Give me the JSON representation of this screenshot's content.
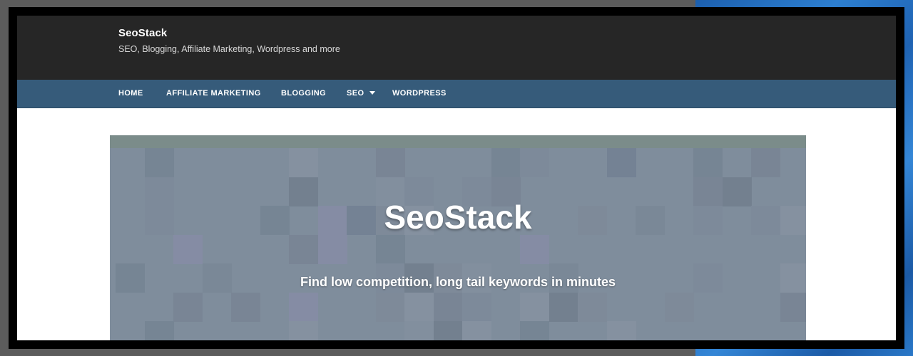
{
  "site": {
    "title": "SeoStack",
    "tagline": "SEO, Blogging, Affiliate Marketing, Wordpress and more"
  },
  "nav": {
    "items": [
      {
        "label": "HOME"
      },
      {
        "label": "AFFILIATE MARKETING"
      },
      {
        "label": "BLOGGING"
      },
      {
        "label": "SEO",
        "has_dropdown": true
      },
      {
        "label": "WORDPRESS"
      }
    ]
  },
  "hero": {
    "title": "SeoStack",
    "subtitle": "Find low competition, long tail keywords in minutes"
  },
  "colors": {
    "header_bg": "#262626",
    "nav_bg": "#365b7a",
    "hero_bg": "#7f8d9c",
    "backdrop_gray": "#5c5c5c",
    "backdrop_blue": "#2a78c8"
  }
}
